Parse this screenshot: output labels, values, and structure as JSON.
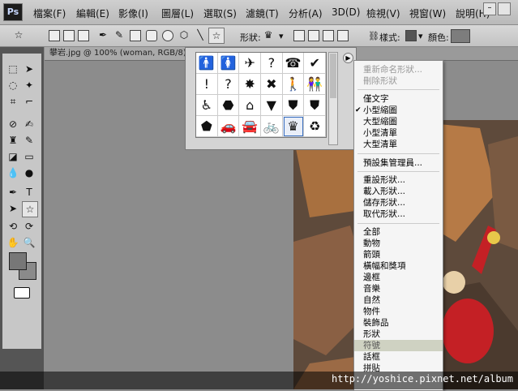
{
  "app": {
    "logo": "Ps"
  },
  "menubar": {
    "items": [
      "檔案(F)",
      "編輯(E)",
      "影像(I)",
      "圖層(L)",
      "選取(S)",
      "濾鏡(T)",
      "分析(A)",
      "3D(D)",
      "檢視(V)",
      "視窗(W)",
      "說明(H)"
    ]
  },
  "options_bar": {
    "shape_label": "形狀:",
    "style_label": "樣式:",
    "color_label": "顏色:",
    "color_value": "#7d7d7d"
  },
  "document": {
    "tab_title": "攀岩.jpg @ 100% (woman, RGB/8) *"
  },
  "shape_picker": {
    "shapes": [
      "🚹",
      "🚺",
      "✈",
      "?",
      "☎",
      "✔",
      "!",
      "?",
      "✸",
      "✖",
      "🚶",
      "👫",
      "♿",
      "⬣",
      "⌂",
      "▼",
      "⛊",
      "⛊",
      "⬟",
      "🚗",
      "🚘",
      "🚲",
      "",
      "♻"
    ]
  },
  "dropdown": {
    "items": [
      {
        "label": "重新命名形狀...",
        "disabled": true
      },
      {
        "label": "刪除形狀",
        "disabled": true
      },
      {
        "label": "僅文字"
      },
      {
        "label": "小型縮圖",
        "checked": true
      },
      {
        "label": "大型縮圖"
      },
      {
        "label": "小型清單"
      },
      {
        "label": "大型清單"
      },
      {
        "label": "預設集管理員..."
      },
      {
        "label": "重設形狀..."
      },
      {
        "label": "載入形狀..."
      },
      {
        "label": "儲存形狀..."
      },
      {
        "label": "取代形狀..."
      },
      {
        "label": "全部"
      },
      {
        "label": "動物"
      },
      {
        "label": "箭頭"
      },
      {
        "label": "橫幅和獎項"
      },
      {
        "label": "邊框"
      },
      {
        "label": "音樂"
      },
      {
        "label": "自然"
      },
      {
        "label": "物件"
      },
      {
        "label": "裝飾品"
      },
      {
        "label": "形狀"
      },
      {
        "label": "符號",
        "highlighted": true
      },
      {
        "label": "話框"
      },
      {
        "label": "拼貼"
      }
    ]
  },
  "watermark": "http://yoshice.pixnet.net/album"
}
